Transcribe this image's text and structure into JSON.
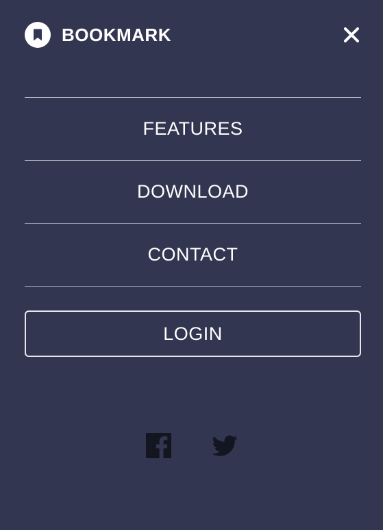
{
  "header": {
    "brand_name": "BOOKMARK",
    "logo_icon": "bookmark-icon",
    "close_icon": "close-icon"
  },
  "nav": {
    "items": [
      {
        "label": "FEATURES"
      },
      {
        "label": "DOWNLOAD"
      },
      {
        "label": "CONTACT"
      }
    ]
  },
  "login": {
    "label": "LOGIN"
  },
  "social": {
    "icons": [
      "facebook-icon",
      "twitter-icon"
    ]
  },
  "colors": {
    "background": "#323650",
    "text": "#ffffff",
    "divider": "#b9bbc8",
    "social_icon": "#131520"
  }
}
